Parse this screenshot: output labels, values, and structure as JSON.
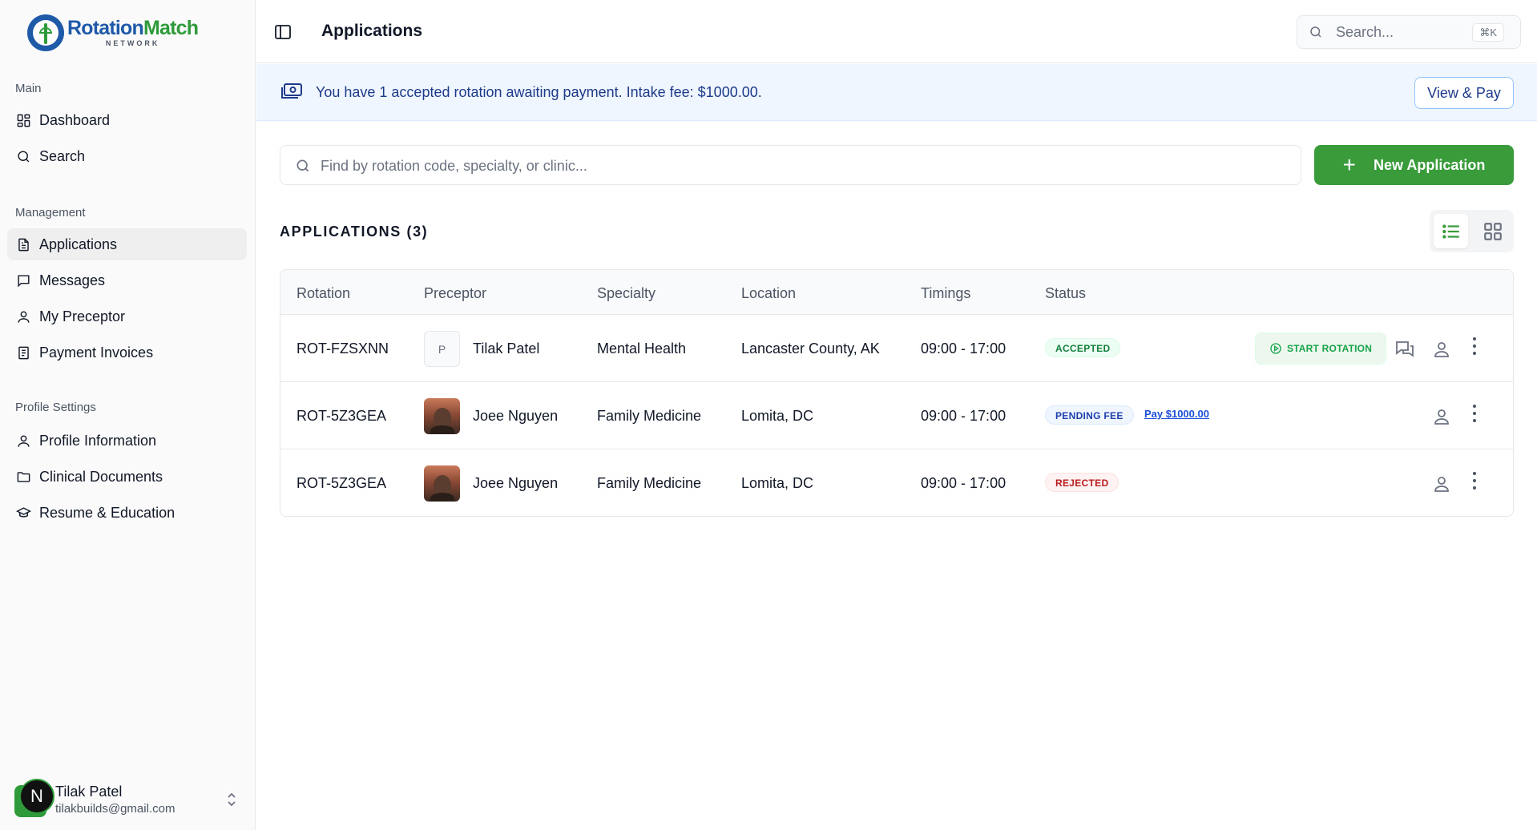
{
  "brand": {
    "name_part1": "Rotation",
    "name_part2": "Match",
    "sub": "NETWORK"
  },
  "sidebar": {
    "sections": {
      "main": "Main",
      "management": "Management",
      "profile": "Profile Settings"
    },
    "items": [
      {
        "label": "Dashboard",
        "icon": "dashboard-icon"
      },
      {
        "label": "Search",
        "icon": "search-icon"
      },
      {
        "label": "Applications",
        "icon": "document-icon",
        "active": true
      },
      {
        "label": "Messages",
        "icon": "message-icon"
      },
      {
        "label": "My Preceptor",
        "icon": "user-icon"
      },
      {
        "label": "Payment Invoices",
        "icon": "invoice-icon"
      },
      {
        "label": "Profile Information",
        "icon": "user-icon"
      },
      {
        "label": "Clinical Documents",
        "icon": "folder-icon"
      },
      {
        "label": "Resume & Education",
        "icon": "graduation-cap-icon"
      }
    ],
    "user": {
      "initial": "N",
      "name": "Tilak Patel",
      "email": "tilakbuilds@gmail.com"
    }
  },
  "header": {
    "title": "Applications",
    "search_placeholder": "Search...",
    "shortcut": "⌘K"
  },
  "banner": {
    "text": "You have 1 accepted rotation awaiting payment. Intake fee: $1000.00.",
    "button": "View & Pay"
  },
  "filter": {
    "placeholder": "Find by rotation code, specialty, or clinic...",
    "new_button": "New Application"
  },
  "applications": {
    "heading": "APPLICATIONS (3)",
    "columns": [
      "Rotation",
      "Preceptor",
      "Specialty",
      "Location",
      "Timings",
      "Status"
    ],
    "rows": [
      {
        "code": "ROT-FZSXNN",
        "preceptor_initial": "P",
        "preceptor": "Tilak Patel",
        "specialty": "Mental Health",
        "location": "Lancaster County, AK",
        "timings": "09:00 - 17:00",
        "status": "ACCEPTED",
        "action": "START ROTATION"
      },
      {
        "code": "ROT-5Z3GEA",
        "preceptor": "Joee Nguyen",
        "specialty": "Family Medicine",
        "location": "Lomita, DC",
        "timings": "09:00 - 17:00",
        "status": "PENDING FEE",
        "pay_link": "Pay $1000.00"
      },
      {
        "code": "ROT-5Z3GEA",
        "preceptor": "Joee Nguyen",
        "specialty": "Family Medicine",
        "location": "Lomita, DC",
        "timings": "09:00 - 17:00",
        "status": "REJECTED"
      }
    ]
  },
  "colors": {
    "brand_green": "#3a9b3a",
    "brand_blue": "#1e5aa8",
    "banner_bg": "#eff6ff"
  }
}
